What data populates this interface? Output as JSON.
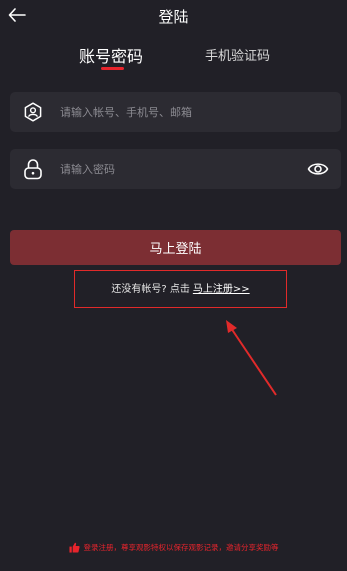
{
  "header": {
    "title": "登陆"
  },
  "tabs": {
    "account": "账号密码",
    "phone": "手机验证码"
  },
  "account_field": {
    "placeholder": "请输入帐号、手机号、邮箱",
    "value": ""
  },
  "password_field": {
    "placeholder": "请输入密码",
    "value": ""
  },
  "login_button": "马上登陆",
  "register": {
    "prompt": "还没有帐号? 点击",
    "link": "马上注册>>"
  },
  "footer": {
    "notice": "登录注册，尊享观影特权以保存观影记录，邀请分享奖励等"
  },
  "colors": {
    "background": "#212027",
    "field_bg": "#2c2b32",
    "accent_red": "#e8242c",
    "button_bg": "#7c2e33",
    "annotation_red": "#e12a2a"
  },
  "icons": {
    "back": "back-arrow-icon",
    "account": "user-badge-icon",
    "password": "lock-icon",
    "visibility": "eye-icon",
    "footer": "thumbs-up-icon"
  }
}
